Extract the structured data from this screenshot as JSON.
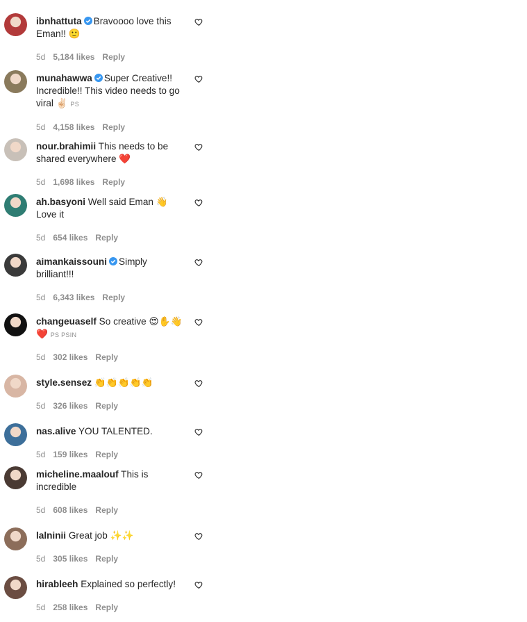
{
  "comments": [
    {
      "user": "ibnhattuta",
      "verified": true,
      "text": "Bravoooo love this Eman!! 🙂",
      "time": "5d",
      "likes": "5,184 likes",
      "reply": "Reply",
      "avatar_color": "#b23a3a"
    },
    {
      "user": "munahawwa",
      "verified": true,
      "text": "Super Creative!! Incredible!! This video needs to go viral ✌🏻",
      "time": "5d",
      "likes": "4,158 likes",
      "reply": "Reply",
      "avatar_color": "#8a7a5c",
      "suffix": "PS"
    },
    {
      "user": "nour.brahimii",
      "verified": false,
      "text": "This needs to be shared everywhere ❤️",
      "time": "5d",
      "likes": "1,698 likes",
      "reply": "Reply",
      "avatar_color": "#c8c0b8"
    },
    {
      "user": "ah.basyoni",
      "verified": false,
      "text": "Well said Eman 👋 Love it",
      "time": "5d",
      "likes": "654 likes",
      "reply": "Reply",
      "avatar_color": "#2f7d73"
    },
    {
      "user": "aimankaissouni",
      "verified": true,
      "text": "Simply brilliant!!!",
      "time": "5d",
      "likes": "6,343 likes",
      "reply": "Reply",
      "avatar_color": "#3a3a3a"
    },
    {
      "user": "changeuaself",
      "verified": false,
      "text": "So creative 😍✋👋 ❤️",
      "time": "5d",
      "likes": "302 likes",
      "reply": "Reply",
      "avatar_color": "#111111",
      "suffix": "PS PSIN"
    },
    {
      "user": "style.sensez",
      "verified": false,
      "text": "👏👏👏👏👏",
      "time": "5d",
      "likes": "326 likes",
      "reply": "Reply",
      "avatar_color": "#d8b6a4"
    },
    {
      "user": "nas.alive",
      "verified": false,
      "text": "YOU TALENTED.",
      "time": "5d",
      "likes": "159 likes",
      "reply": "Reply",
      "avatar_color": "#3d6f9a"
    },
    {
      "user": "micheline.maalouf",
      "verified": false,
      "text": "This is incredible",
      "time": "5d",
      "likes": "608 likes",
      "reply": "Reply",
      "avatar_color": "#4a3a33"
    },
    {
      "user": "lalninii",
      "verified": false,
      "text": "Great job ✨✨",
      "time": "5d",
      "likes": "305 likes",
      "reply": "Reply",
      "avatar_color": "#8c6d5a"
    },
    {
      "user": "hirableeh",
      "verified": false,
      "text": "Explained so perfectly!",
      "time": "5d",
      "likes": "258 likes",
      "reply": "Reply",
      "avatar_color": "#6b4d42"
    }
  ]
}
